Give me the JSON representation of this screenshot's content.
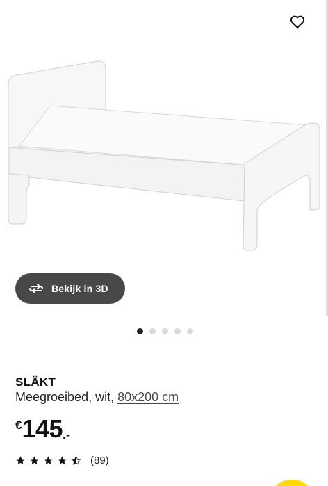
{
  "hero": {
    "view_3d_label": "Bekijk in 3D",
    "carousel_pages": 5,
    "active_page": 1
  },
  "product": {
    "name": "SLÄKT",
    "description_prefix": "Meegroeibed, wit, ",
    "size_link": "80x200 cm",
    "price_currency": "€",
    "price_integer": "145",
    "price_decimal": ".-",
    "rating_value": 4.5,
    "rating_max": 5,
    "review_count": "(89)"
  },
  "icons": {
    "favorite": "heart-outline-icon",
    "view_3d": "rotate-3d-icon",
    "star": "star-icon"
  },
  "colors": {
    "pill_background": "#484848",
    "accent_yellow": "#ffdb00",
    "dot_active": "#222222",
    "dot_inactive": "#d9d9d9"
  }
}
